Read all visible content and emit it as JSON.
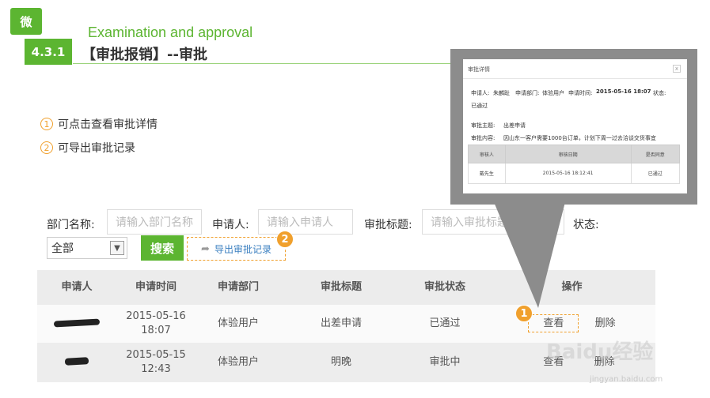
{
  "header": {
    "logo_text": "微",
    "section_badge": "4.3.1",
    "subtitle_en": "Examination and approval",
    "title_cn": "【审批报销】--审批"
  },
  "notes": [
    {
      "num": "1",
      "text": "可点击查看审批详情"
    },
    {
      "num": "2",
      "text": "可导出审批记录"
    }
  ],
  "filters": {
    "dept_label": "部门名称:",
    "dept_placeholder": "请输入部门名称",
    "applicant_label": "申请人:",
    "applicant_placeholder": "请输入申请人",
    "subject_label": "审批标题:",
    "subject_placeholder": "请输入审批标题",
    "status_label": "状态:",
    "dept_select_value": "全部",
    "search_button": "搜索",
    "export_button": "导出审批记录"
  },
  "markers": {
    "view": "1",
    "export": "2"
  },
  "table": {
    "headers": [
      "申请人",
      "申请时间",
      "申请部门",
      "审批标题",
      "审批状态",
      "操作"
    ],
    "rows": [
      {
        "time_date": "2015-05-16",
        "time_clock": "18:07",
        "department": "体验用户",
        "subject": "出差申请",
        "status": "已通过",
        "view": "查看",
        "delete": "删除"
      },
      {
        "time_date": "2015-05-15",
        "time_clock": "12:43",
        "department": "体验用户",
        "subject": "明晚",
        "status": "审批中",
        "view": "查看",
        "delete": "删除"
      }
    ]
  },
  "popup": {
    "title": "审批详情",
    "close": "x",
    "applicant_label": "申请人:",
    "applicant": "朱麟趾",
    "dept_label": "申请部门:",
    "dept": "体验用户",
    "time_label": "申请时间:",
    "time": "2015-05-16 18:07",
    "status_label": "状态:",
    "status": "已通过",
    "subject_label": "审批主题:",
    "subject": "出差申请",
    "content_label": "审批内容:",
    "content": "因山东一客户需要1000台订单，计划下周一过去洽谈交货事宜",
    "table_headers": [
      "审核人",
      "审核日期",
      "是否同意"
    ],
    "table_row": [
      "戴先生",
      "2015-05-16 18:12:41",
      "已通过"
    ]
  },
  "watermark": {
    "main": "Baidu经验",
    "sub": "jingyan.baidu.com"
  },
  "colors": {
    "brand_green": "#5cb531",
    "accent_orange": "#f0a02d",
    "link_blue": "#3a7fc0"
  }
}
